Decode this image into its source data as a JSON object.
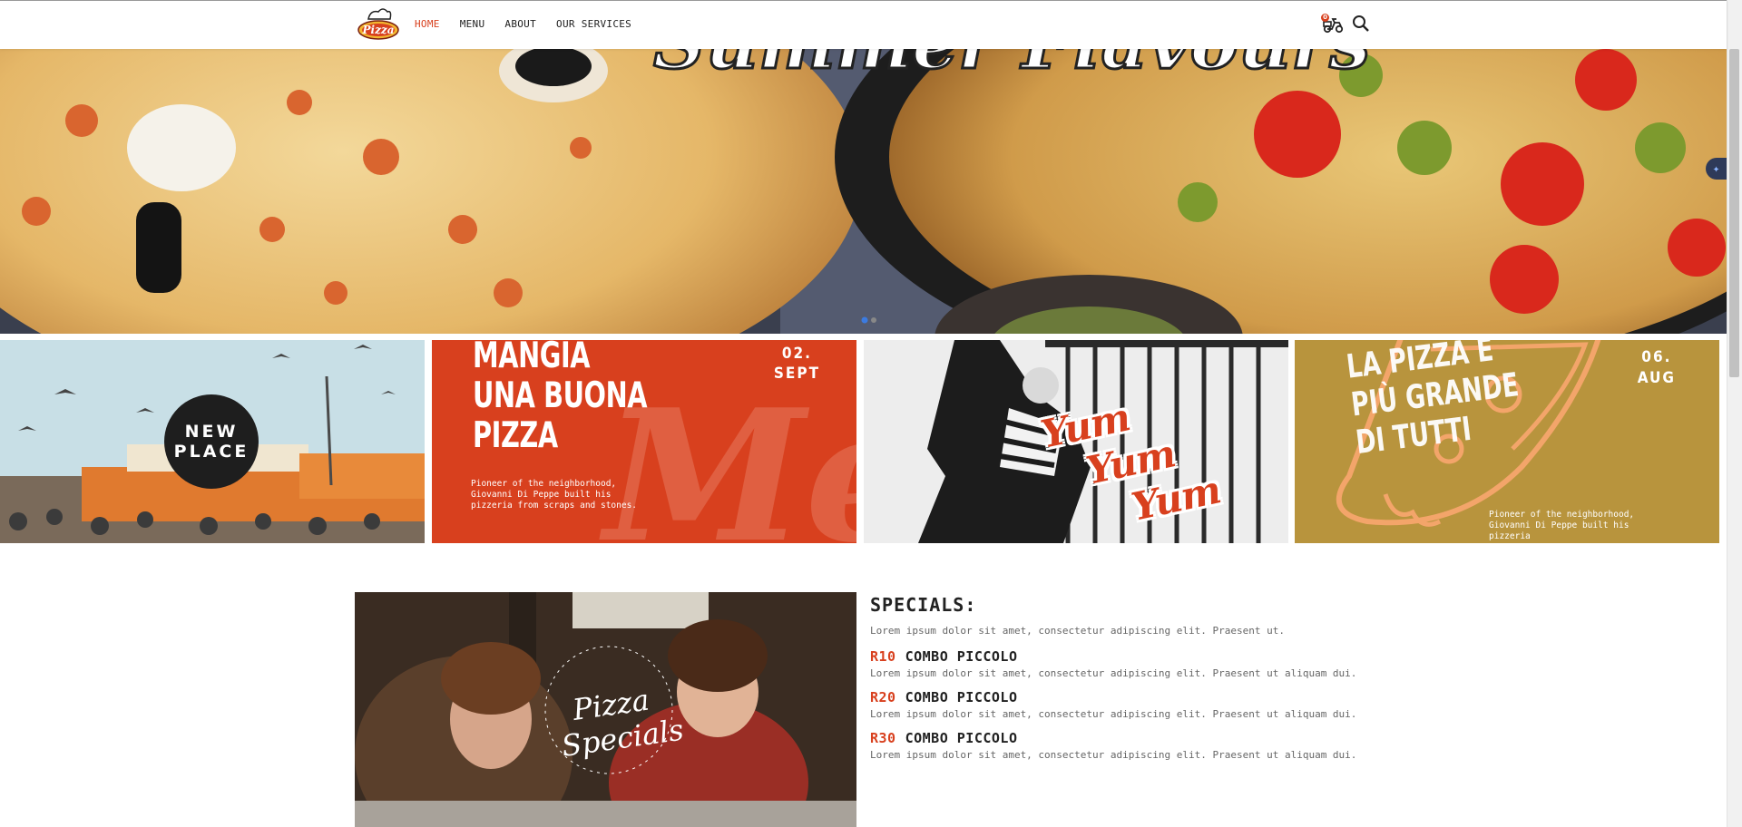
{
  "header": {
    "logo_text": "Pizza",
    "nav": [
      {
        "label": "HOME",
        "active": true
      },
      {
        "label": "MENU",
        "active": false
      },
      {
        "label": "ABOUT",
        "active": false
      },
      {
        "label": "OUR SERVICES",
        "active": false
      }
    ],
    "cart_count": "0"
  },
  "hero": {
    "banner_text": "Summer Flavours"
  },
  "tiles": {
    "new_place": {
      "line1": "NEW",
      "line2": "PLACE"
    },
    "mangia": {
      "title_line1": "MANGIA",
      "title_line2": "UNA BUONA",
      "title_line3": "PIZZA",
      "date_day": "02.",
      "date_month": "SEPT",
      "text": "Pioneer of the neighborhood, Giovanni Di Peppe built his pizzeria from scraps and stones."
    },
    "yum": {
      "word1": "Yum",
      "word2": "Yum",
      "word3": "Yum"
    },
    "la_pizza": {
      "title_line1": "LA PIZZA E",
      "title_line2": "PIÙ GRANDE",
      "title_line3": "DI TUTTI",
      "date_day": "06.",
      "date_month": "AUG",
      "text": "Pioneer of the neighborhood, Giovanni Di Peppe built his pizzeria"
    }
  },
  "specials": {
    "photo_title_line1": "Pizza",
    "photo_title_line2": "Specials",
    "heading": "SPECIALS:",
    "intro": "Lorem ipsum dolor sit amet, consectetur adipiscing elit. Praesent ut.",
    "items": [
      {
        "price": "R10",
        "name": "COMBO PICCOLO",
        "desc": "Lorem ipsum dolor sit amet, consectetur adipiscing elit. Praesent ut aliquam dui."
      },
      {
        "price": "R20",
        "name": "COMBO PICCOLO",
        "desc": "Lorem ipsum dolor sit amet, consectetur adipiscing elit. Praesent ut aliquam dui."
      },
      {
        "price": "R30",
        "name": "COMBO PICCOLO",
        "desc": "Lorem ipsum dolor sit amet, consectetur adipiscing elit. Praesent ut aliquam dui."
      }
    ]
  },
  "colors": {
    "accent": "#d8401e",
    "mustard": "#b8943d",
    "dark": "#1e1e1e"
  },
  "icons": [
    "pizza-logo-icon",
    "scooter-cart-icon",
    "search-icon",
    "ai-assistant-icon"
  ]
}
